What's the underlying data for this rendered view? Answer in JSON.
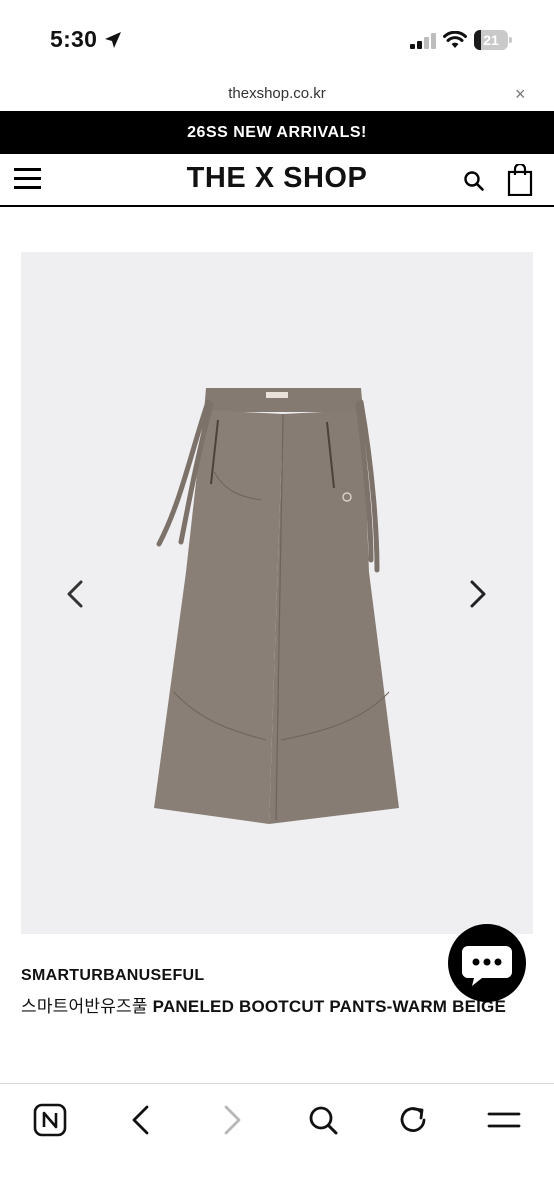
{
  "status_bar": {
    "time": "5:30",
    "battery_level": "21",
    "battery_fraction": 0.21
  },
  "url_bar": {
    "url": "thexshop.co.kr",
    "close_glyph": "×"
  },
  "announcement": {
    "text": "26SS NEW ARRIVALS!"
  },
  "header": {
    "logo": "THE X SHOP",
    "menu_icon": "hamburger-menu-icon",
    "search_icon": "search-icon",
    "cart_icon": "shopping-bag-icon"
  },
  "gallery": {
    "image_subject": "pants",
    "background": "#efeff1",
    "prev_icon": "chevron-left-icon",
    "next_icon": "chevron-right-icon"
  },
  "product": {
    "brand": "SMARTURBANUSEFUL",
    "name_ko": "스마트어반유즈풀",
    "name_en": "PANELED BOOTCUT PANTS-WARM BEIGE"
  },
  "chat": {
    "icon": "chat-bubble-icon"
  },
  "toolbar": {
    "items": [
      "naver-home-icon",
      "back-icon",
      "forward-icon",
      "search-icon",
      "reload-icon",
      "menu-icon"
    ]
  },
  "colors": {
    "announcement_bg": "#000000",
    "pants": "#8a7f76",
    "forward_disabled": "#b8b8b8"
  }
}
